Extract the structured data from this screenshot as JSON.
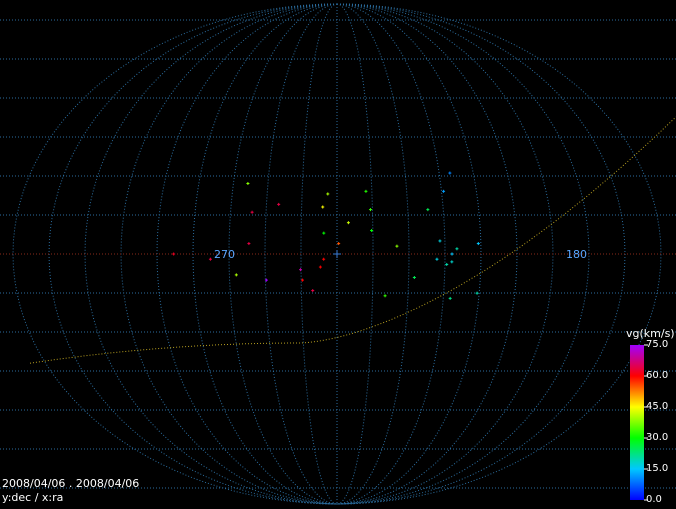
{
  "chart_data": {
    "type": "scatter",
    "projection": "sinusoidal-ellipse",
    "xaxis_labels": [
      {
        "ra": 270,
        "text": "270"
      },
      {
        "ra": 180,
        "text": "180"
      }
    ],
    "date_range": "2008/04/06 . 2008/04/06",
    "axes_caption": "y:dec / x:ra",
    "colorbar": {
      "title": "vg(km/s)",
      "ticks": [
        "75.0",
        "60.0",
        "45.0",
        "30.0",
        "15.0",
        "0.0"
      ],
      "range": [
        0,
        75
      ]
    },
    "grid": true,
    "points": [
      {
        "ra": 307,
        "dec": 27,
        "vg": 38
      },
      {
        "ra": 300,
        "dec": 16,
        "vg": 64
      },
      {
        "ra": 300,
        "dec": 4,
        "vg": 64
      },
      {
        "ra": 323,
        "dec": -2,
        "vg": 64
      },
      {
        "ra": 308,
        "dec": -8,
        "vg": 40
      },
      {
        "ra": 290,
        "dec": -10,
        "vg": 75
      },
      {
        "ra": 284,
        "dec": 19,
        "vg": 64
      },
      {
        "ra": 269,
        "dec": -6,
        "vg": 70
      },
      {
        "ra": 268,
        "dec": -10,
        "vg": 60
      },
      {
        "ra": 262,
        "dec": -14,
        "vg": 64
      },
      {
        "ra": 257,
        "dec": -5,
        "vg": 60
      },
      {
        "ra": 255,
        "dec": -2,
        "vg": 60
      },
      {
        "ra": 345,
        "dec": 0,
        "vg": 62
      },
      {
        "ra": 256,
        "dec": 18,
        "vg": 45
      },
      {
        "ra": 253,
        "dec": 23,
        "vg": 40
      },
      {
        "ra": 255,
        "dec": 8,
        "vg": 30
      },
      {
        "ra": 246,
        "dec": 4,
        "vg": 55
      },
      {
        "ra": 240,
        "dec": 12,
        "vg": 42
      },
      {
        "ra": 228,
        "dec": 24,
        "vg": 32
      },
      {
        "ra": 226,
        "dec": 17,
        "vg": 33
      },
      {
        "ra": 226,
        "dec": 9,
        "vg": 30
      },
      {
        "ra": 211,
        "dec": 3,
        "vg": 38
      },
      {
        "ra": 217,
        "dec": -16,
        "vg": 33
      },
      {
        "ra": 200,
        "dec": -9,
        "vg": 25
      },
      {
        "ra": 190,
        "dec": 17,
        "vg": 25
      },
      {
        "ra": 185,
        "dec": 5,
        "vg": 17
      },
      {
        "ra": 175,
        "dec": 2,
        "vg": 20
      },
      {
        "ra": 177,
        "dec": 24,
        "vg": 12
      },
      {
        "ra": 178,
        "dec": 0,
        "vg": 15
      },
      {
        "ra": 176,
        "dec": -17,
        "vg": 22
      },
      {
        "ra": 168,
        "dec": 31,
        "vg": 10
      },
      {
        "ra": 178,
        "dec": -3,
        "vg": 18
      },
      {
        "ra": 181,
        "dec": -4,
        "vg": 20
      },
      {
        "ra": 162,
        "dec": 4,
        "vg": 15
      },
      {
        "ra": 160,
        "dec": -15,
        "vg": 20
      },
      {
        "ra": 187,
        "dec": -2,
        "vg": 17
      }
    ]
  }
}
